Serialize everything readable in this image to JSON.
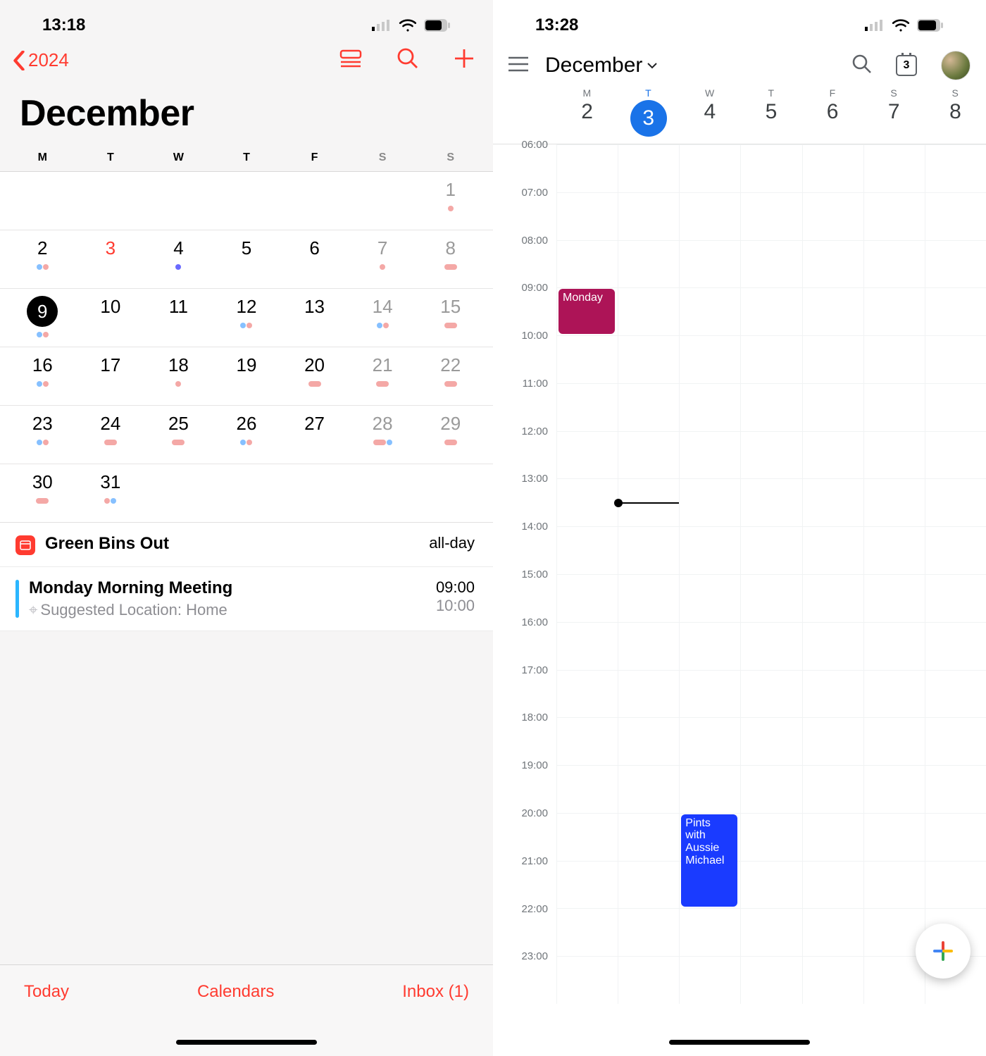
{
  "ios": {
    "status_time": "13:18",
    "back_label": "2024",
    "title": "December",
    "weekdays": [
      "M",
      "T",
      "W",
      "T",
      "F",
      "S",
      "S"
    ],
    "rows": [
      [
        {
          "n": ""
        },
        {
          "n": ""
        },
        {
          "n": ""
        },
        {
          "n": ""
        },
        {
          "n": ""
        },
        {
          "n": ""
        },
        {
          "n": "1",
          "wknd": true,
          "dots": [
            {
              "c": "pk"
            }
          ]
        }
      ],
      [
        {
          "n": "2",
          "dots": [
            {
              "c": "bl"
            },
            {
              "c": "pk"
            }
          ]
        },
        {
          "n": "3",
          "today": true
        },
        {
          "n": "4",
          "dots": [
            {
              "c": "pur"
            }
          ]
        },
        {
          "n": "5"
        },
        {
          "n": "6"
        },
        {
          "n": "7",
          "wknd": true,
          "dots": [
            {
              "c": "pk"
            }
          ]
        },
        {
          "n": "8",
          "wknd": true,
          "dots": [
            {
              "c": "pk",
              "lg": true
            }
          ]
        }
      ],
      [
        {
          "n": "9",
          "sel": true,
          "dots": [
            {
              "c": "bl"
            },
            {
              "c": "pk"
            }
          ]
        },
        {
          "n": "10"
        },
        {
          "n": "11"
        },
        {
          "n": "12",
          "dots": [
            {
              "c": "bl"
            },
            {
              "c": "pk"
            }
          ]
        },
        {
          "n": "13"
        },
        {
          "n": "14",
          "wknd": true,
          "dots": [
            {
              "c": "bl"
            },
            {
              "c": "pk"
            }
          ]
        },
        {
          "n": "15",
          "wknd": true,
          "dots": [
            {
              "c": "pk",
              "lg": true
            }
          ]
        }
      ],
      [
        {
          "n": "16",
          "dots": [
            {
              "c": "bl"
            },
            {
              "c": "pk"
            }
          ]
        },
        {
          "n": "17"
        },
        {
          "n": "18",
          "dots": [
            {
              "c": "pk"
            }
          ]
        },
        {
          "n": "19"
        },
        {
          "n": "20",
          "dots": [
            {
              "c": "pk",
              "lg": true
            }
          ]
        },
        {
          "n": "21",
          "wknd": true,
          "dots": [
            {
              "c": "pk",
              "lg": true
            }
          ]
        },
        {
          "n": "22",
          "wknd": true,
          "dots": [
            {
              "c": "pk",
              "lg": true
            }
          ]
        }
      ],
      [
        {
          "n": "23",
          "dots": [
            {
              "c": "bl"
            },
            {
              "c": "pk"
            }
          ]
        },
        {
          "n": "24",
          "dots": [
            {
              "c": "pk",
              "lg": true
            }
          ]
        },
        {
          "n": "25",
          "dots": [
            {
              "c": "pk",
              "lg": true
            }
          ]
        },
        {
          "n": "26",
          "dots": [
            {
              "c": "bl"
            },
            {
              "c": "pk"
            }
          ]
        },
        {
          "n": "27"
        },
        {
          "n": "28",
          "wknd": true,
          "dots": [
            {
              "c": "pk",
              "lg": true
            },
            {
              "c": "bl"
            }
          ]
        },
        {
          "n": "29",
          "wknd": true,
          "dots": [
            {
              "c": "pk",
              "lg": true
            }
          ]
        }
      ],
      [
        {
          "n": "30",
          "dots": [
            {
              "c": "pk",
              "lg": true
            }
          ]
        },
        {
          "n": "31",
          "dots": [
            {
              "c": "pk"
            },
            {
              "c": "bl"
            }
          ]
        },
        {
          "n": ""
        },
        {
          "n": ""
        },
        {
          "n": ""
        },
        {
          "n": ""
        },
        {
          "n": ""
        }
      ]
    ],
    "events": [
      {
        "icon": "cal",
        "title": "Green Bins Out",
        "right": "all-day"
      },
      {
        "icon": "bar",
        "title": "Monday Morning Meeting",
        "sub": "Suggested Location: Home",
        "start": "09:00",
        "end": "10:00"
      }
    ],
    "tab": {
      "today": "Today",
      "cal": "Calendars",
      "inbox": "Inbox (1)"
    }
  },
  "gcal": {
    "status_time": "13:28",
    "month": "December",
    "today_box": "3",
    "days": [
      {
        "h": "M",
        "n": "2"
      },
      {
        "h": "T",
        "n": "3",
        "today": true
      },
      {
        "h": "W",
        "n": "4"
      },
      {
        "h": "T",
        "n": "5"
      },
      {
        "h": "F",
        "n": "6"
      },
      {
        "h": "S",
        "n": "7"
      },
      {
        "h": "S",
        "n": "8"
      }
    ],
    "hours": [
      "06:00",
      "07:00",
      "08:00",
      "09:00",
      "10:00",
      "11:00",
      "12:00",
      "13:00",
      "14:00",
      "15:00",
      "16:00",
      "17:00",
      "18:00",
      "19:00",
      "20:00",
      "21:00",
      "22:00",
      "23:00"
    ],
    "events": [
      {
        "col": 0,
        "start": 9,
        "end": 10,
        "label": "Monday",
        "color": "magenta"
      },
      {
        "col": 2,
        "start": 20,
        "end": 22,
        "label": "Pints with Aussie Michael",
        "color": "blue"
      }
    ],
    "now": {
      "col": 1,
      "time": 13.5
    }
  }
}
